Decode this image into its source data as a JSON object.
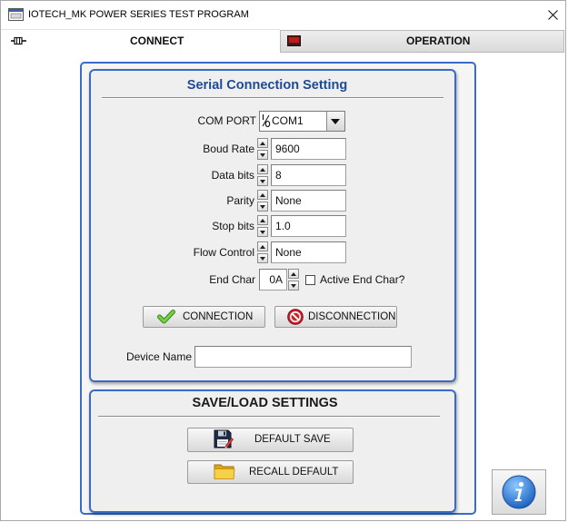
{
  "window": {
    "title": "IOTECH_MK POWER SERIES TEST PROGRAM",
    "app_icon": "app-window-icon",
    "close_icon": "close-icon"
  },
  "tabs": [
    {
      "label": "CONNECT",
      "icon": "plug-icon",
      "active": true
    },
    {
      "label": "OPERATION",
      "icon": "monitor-icon",
      "active": false
    }
  ],
  "serial": {
    "title": "Serial Connection Setting",
    "com_port": {
      "label": "COM PORT",
      "value": "COM1",
      "icon": "io-icon"
    },
    "baud_rate": {
      "label": "Boud Rate",
      "value": "9600"
    },
    "data_bits": {
      "label": "Data bits",
      "value": "8"
    },
    "parity": {
      "label": "Parity",
      "value": "None"
    },
    "stop_bits": {
      "label": "Stop bits",
      "value": "1.0"
    },
    "flow_control": {
      "label": "Flow Control",
      "value": "None"
    },
    "end_char": {
      "label": "End Char",
      "value": "0A"
    },
    "active_end_char": {
      "label": "Active End Char?",
      "checked": false
    },
    "connection_button": {
      "label": "CONNECTION",
      "icon": "check-icon"
    },
    "disconnection_button": {
      "label": "DISCONNECTION",
      "icon": "stop-icon"
    },
    "device_name": {
      "label": "Device Name",
      "value": ""
    }
  },
  "save_load": {
    "title": "SAVE/LOAD SETTINGS",
    "default_save_button": {
      "label": "DEFAULT SAVE",
      "icon": "floppy-disk-icon"
    },
    "recall_default_button": {
      "label": "RECALL DEFAULT",
      "icon": "folder-icon"
    }
  },
  "info_button": {
    "icon": "info-icon"
  },
  "colors": {
    "panel_border": "#3b6cc5",
    "group_title": "#1c4b94",
    "connect_check": "#4fae2b",
    "disconnect_red": "#d2202a",
    "info_blue": "#2f7fd6"
  }
}
